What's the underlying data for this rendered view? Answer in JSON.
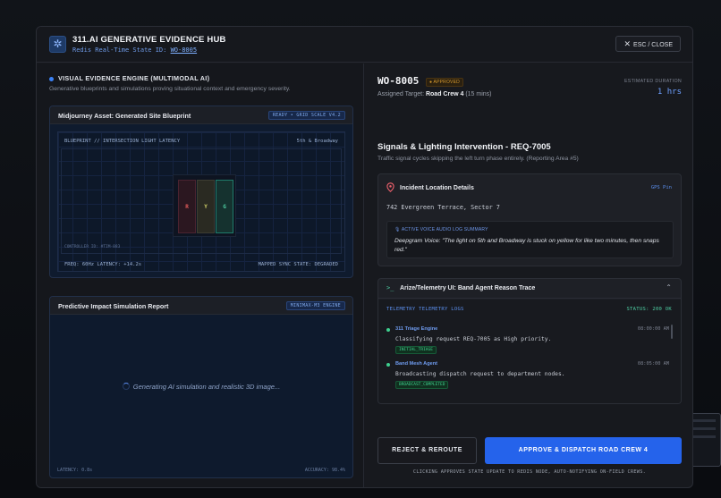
{
  "header": {
    "title": "311.AI GENERATIVE EVIDENCE HUB",
    "subtitle_prefix": "Redis Real-Time State ID:",
    "state_id": "WO-8005",
    "close_label": "ESC / CLOSE"
  },
  "evidence": {
    "title": "VISUAL EVIDENCE ENGINE (MULTIMODAL AI)",
    "description": "Generative blueprints and simulations proving situational context and emergency severity."
  },
  "blueprint_panel": {
    "title": "Midjourney Asset: Generated Site Blueprint",
    "badge": "READY • GRID SCALE V4.2",
    "heading": "BLUEPRINT // INTERSECTION LIGHT LATENCY",
    "location": "5th & Broadway",
    "lights": [
      "R",
      "Y",
      "G"
    ],
    "controller": "CONTROLLER ID: #TIM-883",
    "freq": "FREQ: 60Hz LATENCY: +14.2s",
    "sync": "MAPPED SYNC STATE: DEGRADED"
  },
  "simulation_panel": {
    "title": "Predictive Impact Simulation Report",
    "badge": "MINIMAX-M3 ENGINE",
    "loading": "Generating AI simulation and realistic 3D image...",
    "latency": "LATENCY: 0.8s",
    "accuracy": "ACCURACY: 98.4%"
  },
  "work_order": {
    "id": "WO-8005",
    "status": "APPROVED",
    "assigned_prefix": "Assigned Target:",
    "assigned_crew": "Road Crew 4",
    "assigned_eta": "(15 mins)",
    "est_label": "ESTIMATED DURATION",
    "est_value": "1 hrs",
    "title": "Signals & Lighting Intervention - REQ-7005",
    "description": "Traffic signal cycles skipping the left turn phase entirely. (Reporting Area #5)"
  },
  "incident": {
    "title": "Incident Location Details",
    "gps": "GPS Pin",
    "address": "742 Evergreen Terrace, Sector 7",
    "voice_label": "ACTIVE VOICE AUDIO LOG SUMMARY",
    "voice_text": "Deepgram Voice: \"The light on 5th and Broadway is stuck on yellow for like two minutes, then snaps red.\""
  },
  "telemetry": {
    "title": "Arize/Telemetry UI: Band Agent Reason Trace",
    "logs_label": "TELEMETRY TELEMETRY LOGS",
    "status": "STATUS: 200 OK",
    "logs": [
      {
        "agent": "311 Triage Engine",
        "time": "08:00:00 AM",
        "message": "Classifying request REQ-7005 as High priority.",
        "tag": "INITIAL_TRIAGE"
      },
      {
        "agent": "Band Mesh Agent",
        "time": "08:05:00 AM",
        "message": "Broadcasting dispatch request to department nodes.",
        "tag": "BROADCAST_COMPLETED"
      }
    ]
  },
  "actions": {
    "reject": "REJECT & REROUTE",
    "approve": "APPROVE & DISPATCH ROAD CREW 4",
    "note": "CLICKING APPROVES STATE UPDATE TO REDIS NODE, AUTO-NOTIFYING ON-FIELD CREWS."
  },
  "colors": {
    "accent": "#2563eb",
    "success": "#3ecf8e",
    "warning": "#d79a2c"
  }
}
